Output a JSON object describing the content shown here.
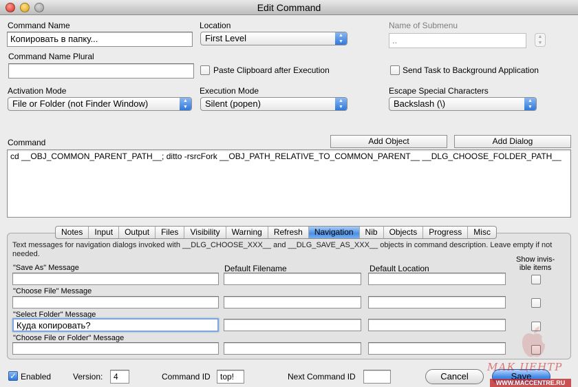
{
  "window": {
    "title": "Edit Command"
  },
  "command_name": {
    "label": "Command Name",
    "value": "Копировать в папку..."
  },
  "location": {
    "label": "Location",
    "value": "First Level"
  },
  "submenu": {
    "label": "Name of Submenu",
    "value": ".."
  },
  "plural": {
    "label": "Command Name Plural",
    "value": ""
  },
  "paste_clipboard": {
    "label": "Paste Clipboard after Execution",
    "checked": false
  },
  "send_background": {
    "label": "Send Task to Background Application",
    "checked": false
  },
  "activation": {
    "label": "Activation Mode",
    "value": "File or Folder (not Finder Window)"
  },
  "execution": {
    "label": "Execution Mode",
    "value": "Silent (popen)"
  },
  "escape": {
    "label": "Escape Special Characters",
    "value": "Backslash (\\)"
  },
  "command": {
    "label": "Command",
    "add_object": "Add Object",
    "add_dialog": "Add Dialog",
    "text": "cd __OBJ_COMMON_PARENT_PATH__; ditto -rsrcFork __OBJ_PATH_RELATIVE_TO_COMMON_PARENT__ __DLG_CHOOSE_FOLDER_PATH__"
  },
  "tabs": [
    "Notes",
    "Input",
    "Output",
    "Files",
    "Visibility",
    "Warning",
    "Refresh",
    "Navigation",
    "Nib",
    "Objects",
    "Progress",
    "Misc"
  ],
  "active_tab": "Navigation",
  "navigation": {
    "help": "Text messages for navigation dialogs invoked with __DLG_CHOOSE_XXX__ and __DLG_SAVE_AS_XXX__ objects in command description. Leave empty if not needed.",
    "col_default_filename": "Default Filename",
    "col_default_location": "Default Location",
    "col_show_invisible": "Show invis-\nible items",
    "rows": [
      {
        "label": "\"Save As\" Message",
        "message": "",
        "filename": "",
        "location": ""
      },
      {
        "label": "\"Choose File\" Message",
        "message": "",
        "filename": "",
        "location": ""
      },
      {
        "label": "\"Select Folder\" Message",
        "message": "Куда копировать?",
        "filename": "",
        "location": ""
      },
      {
        "label": "\"Choose File or Folder\" Message",
        "message": "",
        "filename": "",
        "location": ""
      }
    ]
  },
  "footer": {
    "enabled_label": "Enabled",
    "version_label": "Version:",
    "version_value": "4",
    "command_id_label": "Command ID",
    "command_id_value": "top!",
    "next_id_label": "Next Command ID",
    "next_id_value": "",
    "cancel": "Cancel",
    "save": "Save"
  },
  "watermark": {
    "line1": "МАК ЦЕНТР",
    "line2": "WWW.MACCENTRE.RU"
  },
  "colors": {
    "accent": "#3c86e6",
    "window": "#ececec"
  }
}
